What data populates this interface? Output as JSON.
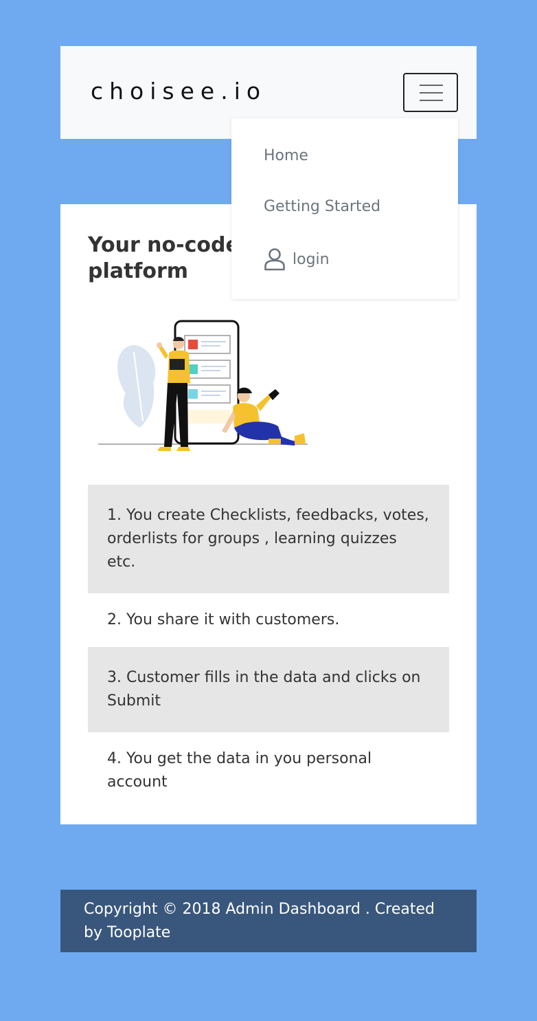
{
  "navbar": {
    "brand": "choisee.io",
    "toggle_label": "Toggle navigation"
  },
  "menu": {
    "items": [
      {
        "label": "Home",
        "icon": null
      },
      {
        "label": "Getting Started",
        "icon": null
      },
      {
        "label": "login",
        "icon": "user-icon"
      }
    ]
  },
  "main": {
    "headline": "Your no-code platform",
    "steps": [
      "1.   You create Checklists, feedbacks, votes, orderlists for groups , learning quizzes etc.",
      "2.   You share it with customers.",
      "3.   Customer fills in the data and clicks on Submit",
      "4.   You get the data in you personal account"
    ]
  },
  "footer": {
    "text": "Copyright © 2018 Admin Dashboard . Created by Tooplate"
  },
  "colors": {
    "page_bg": "#6faaf0",
    "navbar_bg": "#f8f9fa",
    "card_bg": "#ffffff",
    "step_shade": "#e6e6e6",
    "footer_bg": "#39577c",
    "accent_yellow": "#f5c12e",
    "accent_red": "#e74c3c",
    "accent_teal": "#4fd1c5",
    "pants_blue": "#2233aa"
  }
}
